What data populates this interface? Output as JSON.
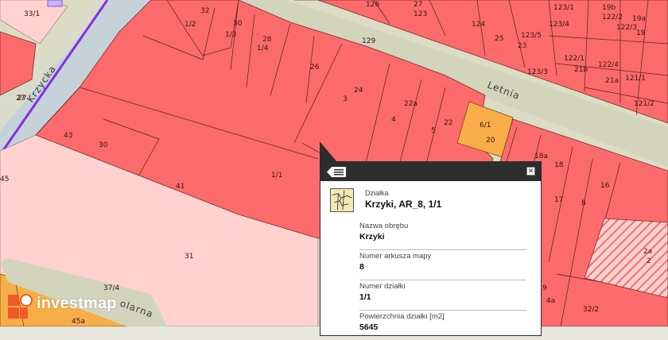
{
  "colors": {
    "plot_red": "#fb6b6b",
    "plot_pink": "#ffd2d0",
    "plot_orange": "#f8ae48",
    "road": "#dcdcc4",
    "river": "#c5d3d8",
    "boundary_purple": "#8a2be2",
    "popup_header": "#2d2d2d",
    "logo_orange": "#f05a28"
  },
  "streets": {
    "krzycka": "Krzycka",
    "letnia": "Letnia",
    "polarna": "olarna"
  },
  "plot_labels": [
    "33/1",
    "32",
    "30",
    "1/2",
    "1/3",
    "28",
    "1/4",
    "26",
    "27",
    "24",
    "3",
    "4",
    "5",
    "22a",
    "22",
    "129",
    "126",
    "27",
    "123",
    "124",
    "25",
    "123/5",
    "23",
    "123/3",
    "123/4",
    "123/1",
    "19b",
    "122/2",
    "19a",
    "122/3",
    "19",
    "122/1",
    "21b",
    "122/4",
    "21a",
    "121/1",
    "121/2",
    "20",
    "6/1",
    "18a",
    "18",
    "17",
    "16",
    "8",
    "9",
    "2a",
    "2",
    "4a",
    "32/2",
    "43",
    "30",
    "41",
    "1/1",
    "31",
    "45",
    "37/4",
    "45a",
    "27"
  ],
  "popup": {
    "type_label": "Działka",
    "title": "Krzyki, AR_8, 1/1",
    "close_label": "✕",
    "fields": [
      {
        "label": "Nazwa obrębu",
        "value": "Krzyki"
      },
      {
        "label": "Numer arkusza mapy",
        "value": "8"
      },
      {
        "label": "Numer działki",
        "value": "1/1"
      },
      {
        "label": "Powierzchnia działki [m2]",
        "value": "5645"
      }
    ]
  },
  "logo": {
    "text": "investmap"
  }
}
